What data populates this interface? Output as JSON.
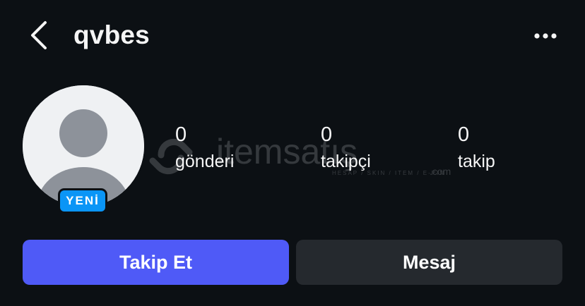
{
  "header": {
    "username": "qvbes",
    "back_icon": "chevron-left-icon",
    "more_icon": "more-horizontal-icon"
  },
  "profile": {
    "avatar_icon": "default-avatar-icon",
    "badge_label": "YENİ"
  },
  "watermark": {
    "brand": "itemsatış",
    "tagline": "HESAP / SKIN / ITEM / E-PIN",
    "domain": ".com"
  },
  "stats": {
    "posts": {
      "count": "0",
      "label": "gönderi"
    },
    "followers": {
      "count": "0",
      "label": "takipçi"
    },
    "following": {
      "count": "0",
      "label": "takip"
    }
  },
  "actions": {
    "follow_label": "Takip Et",
    "message_label": "Mesaj"
  },
  "colors": {
    "background": "#0c1014",
    "follow_button": "#4f5af7",
    "message_button": "#25292e",
    "badge": "#0a95f6"
  }
}
